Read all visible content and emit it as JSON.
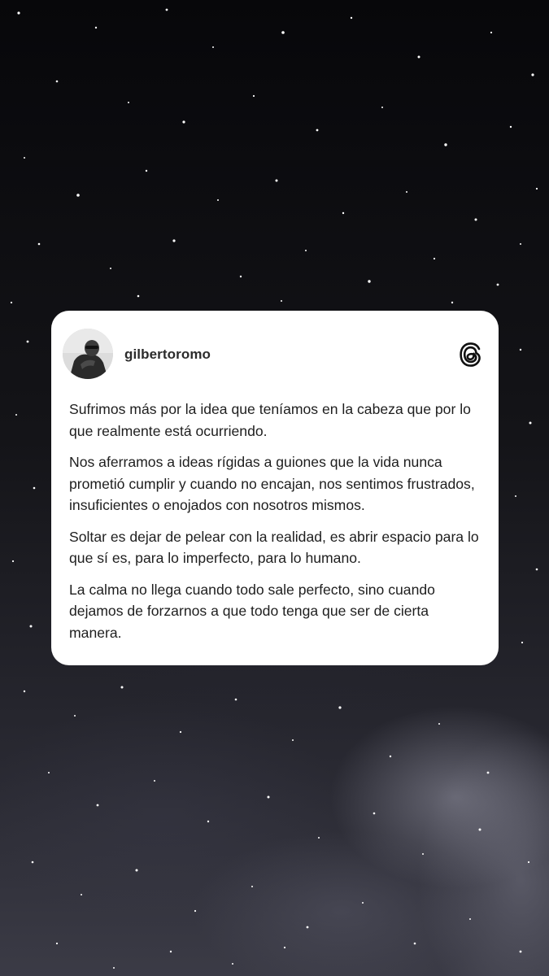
{
  "post": {
    "username": "gilbertoromo",
    "paragraphs": [
      "Sufrimos más por la idea que teníamos en la cabeza que por lo que realmente está ocurriendo.",
      "Nos aferramos a ideas rígidas a guiones que la vida nunca prometió cumplir y cuando no encajan, nos sentimos frustrados, insuficientes o enojados con nosotros mismos.",
      "Soltar es dejar de pelear con la realidad, es abrir espacio para lo que sí es, para lo imperfecto, para lo humano.",
      "La calma no llega cuando todo sale perfecto, sino cuando dejamos de forzarnos a que todo tenga que ser de cierta manera."
    ]
  },
  "icons": {
    "logo": "threads-logo-icon",
    "avatar": "profile-photo"
  },
  "colors": {
    "card": "#ffffff",
    "text": "#1e1e1e",
    "background": "#0b0b0d"
  }
}
